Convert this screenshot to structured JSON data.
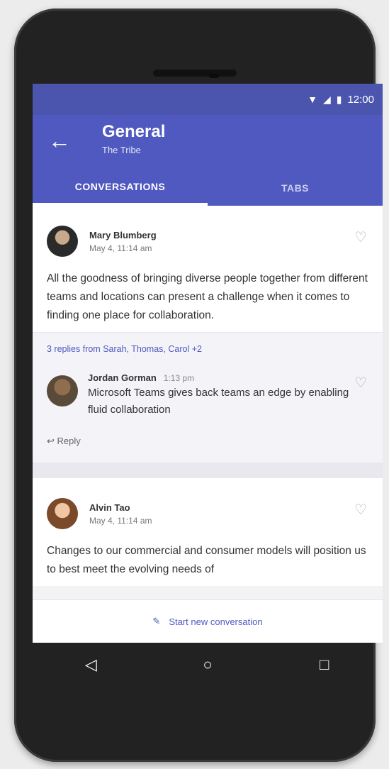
{
  "status_bar": {
    "time": "12:00",
    "wifi_icon": "wifi-icon",
    "signal_icon": "signal-icon",
    "battery_icon": "battery-icon"
  },
  "header": {
    "title": "General",
    "subtitle": "The Tribe",
    "back_icon": "back-arrow-icon"
  },
  "tabs": [
    {
      "label": "CONVERSATIONS",
      "active": true
    },
    {
      "label": "TABS",
      "active": false
    }
  ],
  "posts": [
    {
      "author": "Mary Blumberg",
      "date": "May 4, 11:14 am",
      "text": "All the goodness of bringing diverse people together from different teams and locations can present a challenge when it comes to finding one place for collaboration.",
      "replies_summary": "3 replies from Sarah, Thomas, Carol +2",
      "reply": {
        "author": "Jordan Gorman",
        "time": "1:13 pm",
        "text": "Microsoft Teams gives back teams an edge by enabling fluid collaboration"
      },
      "reply_action": "Reply"
    },
    {
      "author": "Alvin Tao",
      "date": "May 4, 11:14 am",
      "text": "Changes to our commercial and consumer models will position us to best meet the evolving needs of"
    }
  ],
  "footer": {
    "label": "Start new conversation",
    "icon": "compose-icon"
  },
  "nav": {
    "back": "◁",
    "home": "○",
    "recents": "□"
  },
  "colors": {
    "brand": "#5059c0",
    "status_bar": "#4c55ae"
  }
}
